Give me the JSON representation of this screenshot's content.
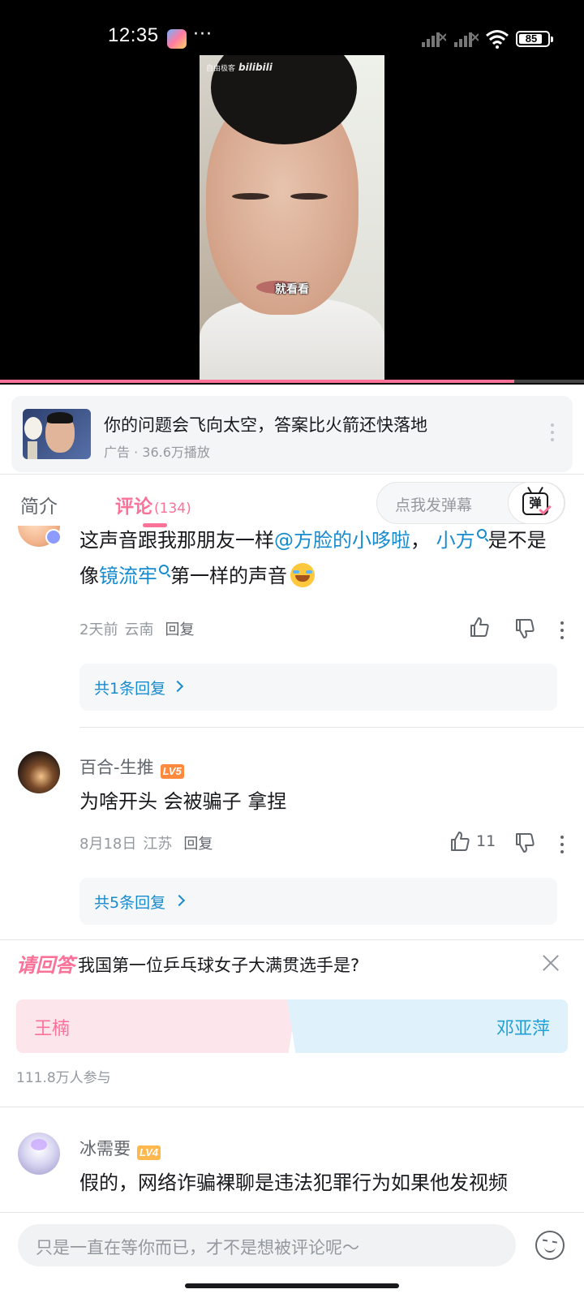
{
  "status_bar": {
    "time": "12:35",
    "more": "···",
    "battery": "85"
  },
  "video": {
    "watermark": "自由极客",
    "brand": "bilibili",
    "subtitle": "就看看",
    "progress": 0.88
  },
  "ad": {
    "title": "你的问题会飞向太空，答案比火箭还快落地",
    "meta": "广告 · 36.6万播放"
  },
  "tabs": {
    "intro": "简介",
    "comments": "评论",
    "comments_count": "(134)",
    "danmaku_placeholder": "点我发弹幕",
    "danmaku_btn": "弹"
  },
  "comments": [
    {
      "text_parts": [
        "这声音跟我那朋友一样",
        "@方脸的小哆啦",
        "，",
        "小方",
        "是不是像",
        "镜流牢",
        "第一样的声音"
      ],
      "date": "2天前",
      "location": "云南",
      "reply": "回复",
      "replies_label": "共1条回复"
    },
    {
      "user": "百合-生推",
      "level": "LV5",
      "text": "为啥开头 会被骗子 拿捏",
      "date": "8月18日",
      "location": "江苏",
      "reply": "回复",
      "likes": "11",
      "replies_label": "共5条回复"
    },
    {
      "user": "冰需要",
      "level": "LV4",
      "text": "假的，网络诈骗裸聊是违法犯罪行为如果他发视频"
    }
  ],
  "poll": {
    "tag": "请回答",
    "question": "我国第一位乒乓球女子大满贯选手是?",
    "option_a": "王楠",
    "option_b": "邓亚萍",
    "participants": "111.8万人参与"
  },
  "bottom": {
    "placeholder": "只是一直在等你而已，才不是想被评论呢～"
  },
  "colors": {
    "accent": "#fb7299",
    "link": "#178bcf",
    "muted": "#9499a0"
  }
}
